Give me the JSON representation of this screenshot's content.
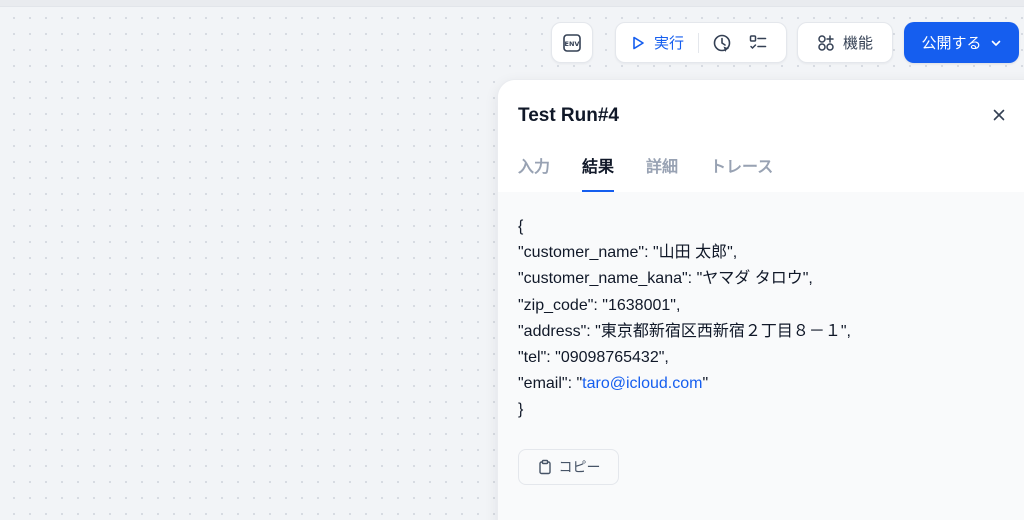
{
  "toolbar": {
    "env_label": "ENV",
    "run_label": "実行",
    "features_label": "機能",
    "publish_label": "公開する"
  },
  "panel": {
    "title": "Test Run#4",
    "tabs": [
      {
        "label": "入力",
        "active": false
      },
      {
        "label": "結果",
        "active": true
      },
      {
        "label": "詳細",
        "active": false
      },
      {
        "label": "トレース",
        "active": false
      }
    ],
    "result": {
      "open_brace": "{",
      "lines": [
        {
          "text": "\"customer_name\": \"山田 太郎\","
        },
        {
          "text": "\"customer_name_kana\": \"ヤマダ タロウ\","
        },
        {
          "text": "\"zip_code\": \"1638001\","
        },
        {
          "text": "\"address\": \"東京都新宿区西新宿２丁目８－１\","
        },
        {
          "text": "\"tel\": \"09098765432\","
        }
      ],
      "email_key": "\"email\": \"",
      "email_value": "taro@icloud.com",
      "email_suffix": "\"",
      "close_brace": "}"
    },
    "copy_label": "コピー"
  },
  "colors": {
    "accent": "#155eef",
    "canvas": "#f2f4f7",
    "panel_body": "#f9fafb"
  },
  "icons": [
    "env-icon",
    "play-icon",
    "history-icon",
    "checklist-icon",
    "features-icon",
    "chevron-down-icon",
    "close-icon",
    "clipboard-icon"
  ]
}
